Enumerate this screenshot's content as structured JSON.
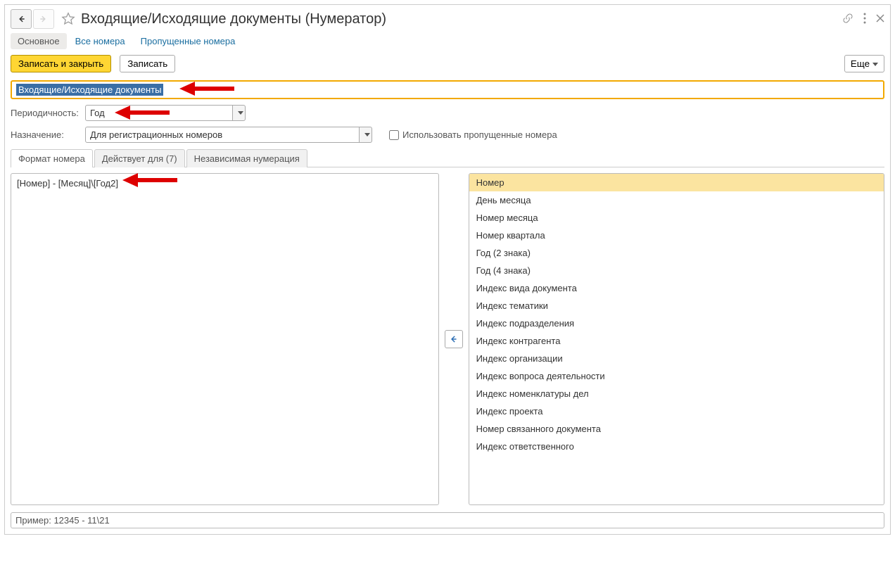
{
  "title": "Входящие/Исходящие документы (Нумератор)",
  "nav": {
    "main": "Основное",
    "all_numbers": "Все номера",
    "skipped": "Пропущенные номера"
  },
  "toolbar": {
    "save_close": "Записать и закрыть",
    "save": "Записать",
    "more": "Еще"
  },
  "name_value": "Входящие/Исходящие документы",
  "periodicity": {
    "label": "Периодичность:",
    "value": "Год"
  },
  "purpose": {
    "label": "Назначение:",
    "value": "Для регистрационных номеров"
  },
  "use_skipped_label": "Использовать пропущенные номера",
  "tabs": {
    "format": "Формат номера",
    "applies": "Действует для (7)",
    "independent": "Независимая нумерация"
  },
  "format_value": "[Номер] - [Месяц]\\[Год2]",
  "items": [
    "Номер",
    "День месяца",
    "Номер месяца",
    "Номер квартала",
    "Год (2 знака)",
    "Год (4 знака)",
    "Индекс вида документа",
    "Индекс тематики",
    "Индекс подразделения",
    "Индекс контрагента",
    "Индекс организации",
    "Индекс вопроса деятельности",
    "Индекс номенклатуры дел",
    "Индекс проекта",
    "Номер связанного документа",
    "Индекс ответственного"
  ],
  "example": "Пример: 12345 - 11\\21"
}
